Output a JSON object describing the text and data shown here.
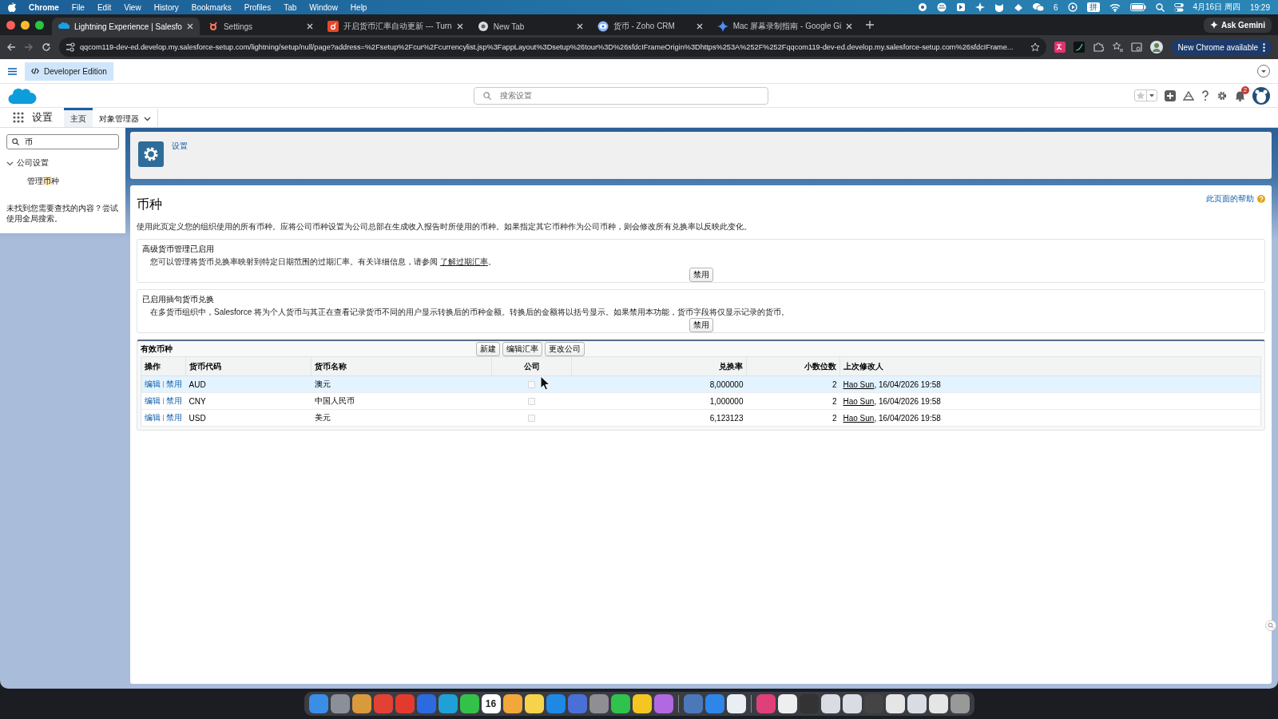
{
  "menubar": {
    "app": "Chrome",
    "menus": [
      "File",
      "Edit",
      "View",
      "History",
      "Bookmarks",
      "Profiles",
      "Tab",
      "Window",
      "Help"
    ],
    "wechat_count": "6",
    "ime": "拼",
    "date": "4月16日 周四",
    "time": "19:29"
  },
  "browser": {
    "tabs": [
      {
        "title": "Lightning Experience | Salesfo",
        "selected": true
      },
      {
        "title": "Settings",
        "selected": false
      },
      {
        "title": "开启货币汇率自动更新 --- Turn",
        "selected": false
      },
      {
        "title": "New Tab",
        "selected": false
      },
      {
        "title": "货币 - Zoho CRM",
        "selected": false
      },
      {
        "title": "Mac 屏幕录制指南 - Google Gi",
        "selected": false
      }
    ],
    "ask": "Ask Gemini",
    "url": "qqcom119-dev-ed.develop.my.salesforce-setup.com/lightning/setup/null/page?address=%2Fsetup%2Fcur%2Fcurrencylist.jsp%3FappLayout%3Dsetup%26tour%3D%26sfdcIFrameOrigin%3Dhttps%253A%252F%252Fqqcom119-dev-ed.develop.my.salesforce-setup.com%26sfdcIFrame...",
    "update": "New Chrome available"
  },
  "sf": {
    "edition": "Developer Edition",
    "search_placeholder": "搜索设置",
    "notifications": "2",
    "app": "设置",
    "nav": [
      {
        "label": "主页",
        "selected": true,
        "menu": false
      },
      {
        "label": "对象管理器",
        "selected": false,
        "menu": true
      }
    ]
  },
  "sidebar": {
    "search_value": "币",
    "tree": [
      {
        "label": "公司设置",
        "expanded": true,
        "children": [
          {
            "parts": [
              {
                "text": "管理",
                "highlighted": false
              },
              {
                "text": "币",
                "highlighted": true
              },
              {
                "text": "种",
                "highlighted": false
              }
            ]
          }
        ]
      }
    ],
    "not_found": "未找到您需要查找的内容？尝试使用全局搜索。"
  },
  "header": {
    "breadcrumb": "设置"
  },
  "page": {
    "title": "币种",
    "help": "此页面的帮助",
    "description": "使用此页定义您的组织使用的所有币种。应将公司币种设置为公司总部在生成收入报告时所使用的币种。如果指定其它币种作为公司币种，则会修改所有兑换率以反映此变化。",
    "sections": [
      {
        "title": "高级货币管理已启用",
        "text_before": "您可以管理将货币兑换率映射到特定日期范围的过期汇率。有关详细信息，请参阅 ",
        "link": "了解过期汇率",
        "text_after": "。",
        "button": "禁用"
      },
      {
        "title": "已启用插句货币兑换",
        "text_before": "在多货币组织中，Salesforce 将为个人货币与其正在查看记录货币不同的用户显示转换后的币种金额。转换后的金额将以括号显示。如果禁用本功能，货币字段将仅显示记录的货币。",
        "button": "禁用"
      }
    ],
    "table": {
      "title": "有效币种",
      "buttons": [
        "新建",
        "编辑汇率",
        "更改公司"
      ],
      "columns": [
        "操作",
        "货币代码",
        "货币名称",
        "公司",
        "兑换率",
        "小数位数",
        "上次修改人"
      ],
      "rows": [
        {
          "actions": [
            "编辑",
            "禁用"
          ],
          "code": "AUD",
          "name": "澳元",
          "corporate": false,
          "rate": "8,000000",
          "decimals": "2",
          "user": "Hao Sun",
          "date": ", 16/04/2026 19:58",
          "highlighted": true
        },
        {
          "actions": [
            "编辑",
            "禁用"
          ],
          "code": "CNY",
          "name": "中国人民币",
          "corporate": false,
          "rate": "1,000000",
          "decimals": "2",
          "user": "Hao Sun",
          "date": ", 16/04/2026 19:58",
          "highlighted": false
        },
        {
          "actions": [
            "编辑",
            "禁用"
          ],
          "code": "USD",
          "name": "美元",
          "corporate": false,
          "rate": "6,123123",
          "decimals": "2",
          "user": "Hao Sun",
          "date": ", 16/04/2026 19:58",
          "highlighted": false
        }
      ]
    }
  },
  "dock": {
    "calendar_day": "16"
  }
}
